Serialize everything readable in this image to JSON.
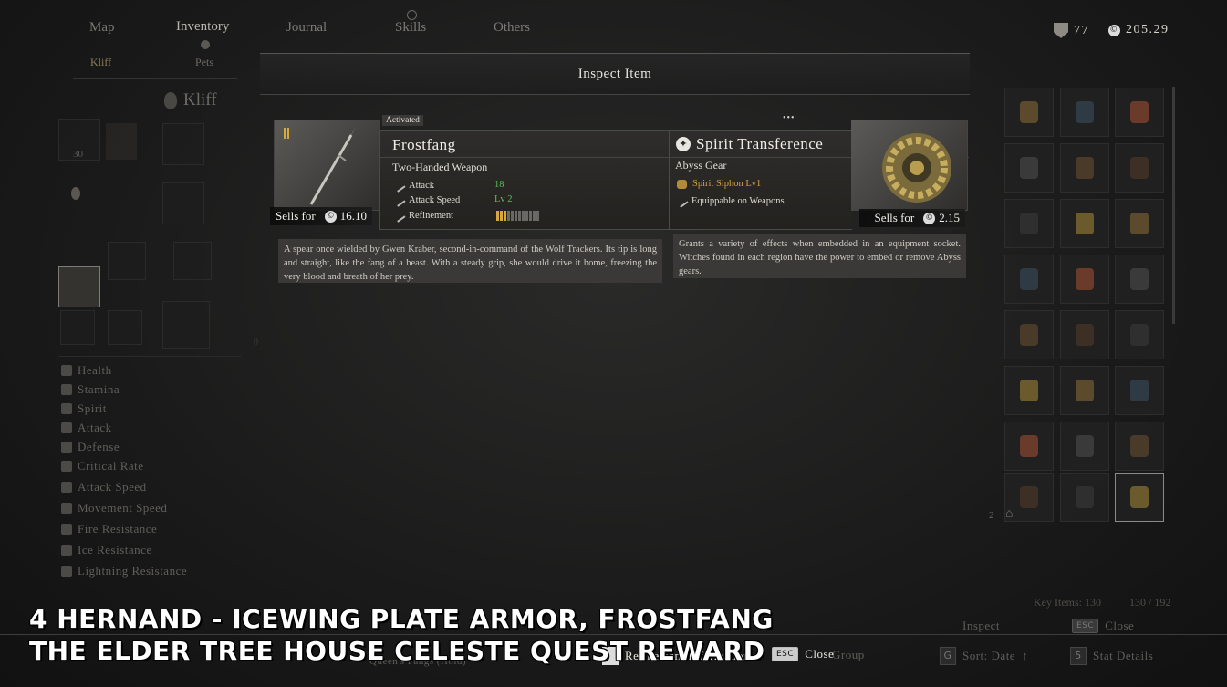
{
  "top_nav": {
    "tabs": [
      {
        "label": "Map"
      },
      {
        "label": "Inventory"
      },
      {
        "label": "Journal"
      },
      {
        "label": "Skills"
      },
      {
        "label": "Others"
      }
    ],
    "sub_tabs": [
      {
        "label": "Kliff"
      },
      {
        "label": "Pets"
      }
    ],
    "currency": {
      "shield_value": "77",
      "coin_value": "205.29",
      "coin_symbol": "©"
    }
  },
  "left_panel": {
    "character_name": "Kliff",
    "slot_number": "30",
    "stat_zero": "0",
    "stats": [
      {
        "label": "Health",
        "icon": "heart-icon"
      },
      {
        "label": "Stamina",
        "icon": "stamina-icon"
      },
      {
        "label": "Spirit",
        "icon": "spirit-icon"
      },
      {
        "label": "Attack",
        "icon": "sword-icon"
      },
      {
        "label": "Defense",
        "icon": "shield-icon"
      },
      {
        "label": "Critical Rate",
        "icon": "critical-icon"
      },
      {
        "label": "Attack Speed",
        "icon": "attack-speed-icon"
      },
      {
        "label": "Movement Speed",
        "icon": "boot-icon"
      },
      {
        "label": "Fire Resistance",
        "icon": "fire-icon"
      },
      {
        "label": "Ice Resistance",
        "icon": "snowflake-icon"
      },
      {
        "label": "Lightning Resistance",
        "icon": "lightning-icon"
      }
    ]
  },
  "inspect": {
    "title": "Inspect Item",
    "pager_dots": "•••",
    "weapon": {
      "badge": "Activated",
      "name": "Frostfang",
      "type": "Two-Handed Weapon",
      "stats": [
        {
          "label": "Attack",
          "value": "18"
        },
        {
          "label": "Attack Speed",
          "value": "Lv 2"
        },
        {
          "label": "Refinement",
          "value": ""
        }
      ],
      "refinement_filled": 3,
      "refinement_total": 12,
      "sells_label": "Sells for",
      "sells_value": "16.10",
      "description": "A spear once wielded by Gwen Kraber, second-in-command of the Wolf Trackers. Its tip is long and straight, like the fang of a beast. With a steady grip, she would drive it home, freezing the very blood and breath of her prey."
    },
    "gear": {
      "name": "Spirit Transference",
      "type": "Abyss Gear",
      "lines": [
        {
          "label": "Spirit Siphon Lv1",
          "color": "#d9a441"
        },
        {
          "label": "Equippable on Weapons",
          "color": "#dedbd4"
        }
      ],
      "sells_label": "Sells for",
      "sells_value": "2.15",
      "description": "Grants a variety of effects when embedded in an equipment socket. Witches found in each region have the power to embed or remove Abyss gears."
    }
  },
  "right_panel": {
    "key_items": "Key Items: 130",
    "capacity": "130 / 192",
    "badge_count": "2"
  },
  "actions": {
    "refinement": {
      "key": "",
      "label": "Refinement Information"
    },
    "close": {
      "key": "ESC",
      "label": "Close"
    },
    "inspect_dim": {
      "label": "Inspect"
    },
    "close_dim": {
      "key": "ESC",
      "label": "Close"
    },
    "group_dim": {
      "label": "Group"
    },
    "sort_dim": {
      "key": "G",
      "label": "Sort: Date"
    },
    "stat_details_dim": {
      "key": "5",
      "label": "Stat Details"
    },
    "hidden_row": {
      "label": "Queen's Fangs (Hold)"
    }
  },
  "caption": {
    "line1": "4 HERNAND - ICEWING PLATE ARMOR, FROSTFANG",
    "line2": "THE ELDER TREE HOUSE CELESTE QUEST REWARD"
  },
  "colors": {
    "green_value": "#58c05c",
    "gold": "#d7a93a"
  }
}
